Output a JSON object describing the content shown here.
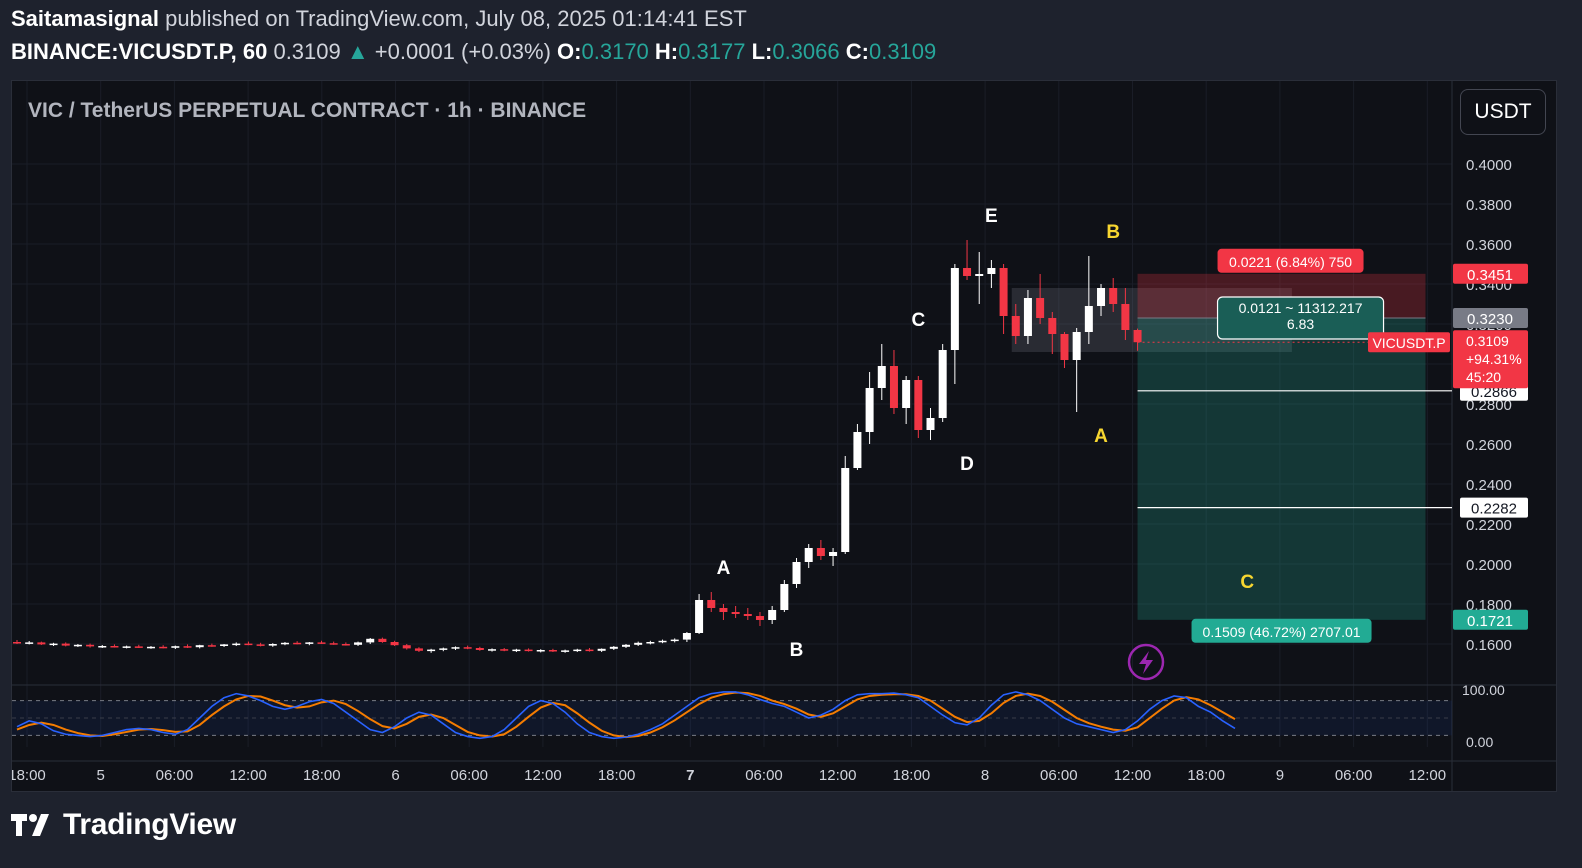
{
  "header": {
    "author": "Saitamasignal",
    "published": "published on TradingView.com, July 08, 2025 01:14:41 EST",
    "symbol": "BINANCE:VICUSDT.P, 60",
    "last": "0.3109",
    "change": "+0.0001 (+0.03%)",
    "o_label": "O:",
    "o_value": "0.3170",
    "h_label": "H:",
    "h_value": "0.3177",
    "l_label": "L:",
    "l_value": "0.3066",
    "c_label": "C:",
    "c_value": "0.3109"
  },
  "title": "VIC / TetherUS PERPETUAL CONTRACT · 1h · BINANCE",
  "currency_button": "USDT",
  "logo_text": "TradingView",
  "colors": {
    "up": "#ffffff",
    "down": "#f23645",
    "accent_green": "#26a69a",
    "wave_white": "#ffffff",
    "wave_yellow": "#f7d630",
    "stoch_k": "#2962ff",
    "stoch_d": "#f57c00"
  },
  "chart_data": {
    "type": "candlestick",
    "y_ticks": [
      "0.1600",
      "0.1800",
      "0.2000",
      "0.2200",
      "0.2400",
      "0.2600",
      "0.2800",
      "0.3000",
      "0.3200",
      "0.3400",
      "0.3600",
      "0.3800",
      "0.4000"
    ],
    "ylim": [
      0.15,
      0.41
    ],
    "x_ticks": [
      {
        "label": "18:00",
        "bold": false
      },
      {
        "label": "5",
        "bold": false
      },
      {
        "label": "06:00",
        "bold": false
      },
      {
        "label": "12:00",
        "bold": false
      },
      {
        "label": "18:00",
        "bold": false
      },
      {
        "label": "6",
        "bold": false
      },
      {
        "label": "06:00",
        "bold": false
      },
      {
        "label": "12:00",
        "bold": false
      },
      {
        "label": "18:00",
        "bold": false
      },
      {
        "label": "7",
        "bold": true
      },
      {
        "label": "06:00",
        "bold": false
      },
      {
        "label": "12:00",
        "bold": false
      },
      {
        "label": "18:00",
        "bold": false
      },
      {
        "label": "8",
        "bold": false
      },
      {
        "label": "06:00",
        "bold": false
      },
      {
        "label": "12:00",
        "bold": false
      },
      {
        "label": "18:00",
        "bold": false
      },
      {
        "label": "9",
        "bold": false
      },
      {
        "label": "06:00",
        "bold": false
      },
      {
        "label": "12:00",
        "bold": false
      }
    ],
    "candles": [
      {
        "o": 0.161,
        "h": 0.162,
        "l": 0.16,
        "c": 0.1605
      },
      {
        "o": 0.1605,
        "h": 0.1615,
        "l": 0.1598,
        "c": 0.1608
      },
      {
        "o": 0.1608,
        "h": 0.1612,
        "l": 0.1595,
        "c": 0.1598
      },
      {
        "o": 0.1598,
        "h": 0.1606,
        "l": 0.159,
        "c": 0.1602
      },
      {
        "o": 0.1602,
        "h": 0.1608,
        "l": 0.1588,
        "c": 0.1592
      },
      {
        "o": 0.1592,
        "h": 0.16,
        "l": 0.1585,
        "c": 0.1596
      },
      {
        "o": 0.1596,
        "h": 0.1602,
        "l": 0.1582,
        "c": 0.1588
      },
      {
        "o": 0.1588,
        "h": 0.1595,
        "l": 0.158,
        "c": 0.159
      },
      {
        "o": 0.159,
        "h": 0.1598,
        "l": 0.1582,
        "c": 0.1585
      },
      {
        "o": 0.1585,
        "h": 0.1592,
        "l": 0.1578,
        "c": 0.1588
      },
      {
        "o": 0.1588,
        "h": 0.1596,
        "l": 0.158,
        "c": 0.1583
      },
      {
        "o": 0.1583,
        "h": 0.159,
        "l": 0.1576,
        "c": 0.1586
      },
      {
        "o": 0.1586,
        "h": 0.1594,
        "l": 0.1578,
        "c": 0.1581
      },
      {
        "o": 0.1581,
        "h": 0.1592,
        "l": 0.1575,
        "c": 0.1589
      },
      {
        "o": 0.1589,
        "h": 0.1598,
        "l": 0.158,
        "c": 0.1584
      },
      {
        "o": 0.1584,
        "h": 0.1596,
        "l": 0.1578,
        "c": 0.1594
      },
      {
        "o": 0.1594,
        "h": 0.1602,
        "l": 0.1586,
        "c": 0.159
      },
      {
        "o": 0.159,
        "h": 0.16,
        "l": 0.1585,
        "c": 0.1598
      },
      {
        "o": 0.1598,
        "h": 0.1608,
        "l": 0.159,
        "c": 0.1602
      },
      {
        "o": 0.1602,
        "h": 0.1612,
        "l": 0.1594,
        "c": 0.1598
      },
      {
        "o": 0.1598,
        "h": 0.1606,
        "l": 0.1588,
        "c": 0.1592
      },
      {
        "o": 0.1592,
        "h": 0.1604,
        "l": 0.1586,
        "c": 0.16
      },
      {
        "o": 0.16,
        "h": 0.161,
        "l": 0.1594,
        "c": 0.1606
      },
      {
        "o": 0.1606,
        "h": 0.1614,
        "l": 0.1598,
        "c": 0.1602
      },
      {
        "o": 0.1602,
        "h": 0.161,
        "l": 0.1594,
        "c": 0.1608
      },
      {
        "o": 0.1608,
        "h": 0.1616,
        "l": 0.16,
        "c": 0.1604
      },
      {
        "o": 0.1604,
        "h": 0.1612,
        "l": 0.1596,
        "c": 0.16
      },
      {
        "o": 0.16,
        "h": 0.1608,
        "l": 0.1592,
        "c": 0.1596
      },
      {
        "o": 0.1596,
        "h": 0.1612,
        "l": 0.159,
        "c": 0.1608
      },
      {
        "o": 0.1608,
        "h": 0.163,
        "l": 0.16,
        "c": 0.1626
      },
      {
        "o": 0.1626,
        "h": 0.1632,
        "l": 0.1606,
        "c": 0.161
      },
      {
        "o": 0.161,
        "h": 0.1616,
        "l": 0.159,
        "c": 0.1594
      },
      {
        "o": 0.1594,
        "h": 0.16,
        "l": 0.1572,
        "c": 0.1578
      },
      {
        "o": 0.1578,
        "h": 0.1584,
        "l": 0.156,
        "c": 0.1566
      },
      {
        "o": 0.1566,
        "h": 0.1576,
        "l": 0.1556,
        "c": 0.1572
      },
      {
        "o": 0.1572,
        "h": 0.1582,
        "l": 0.1564,
        "c": 0.1578
      },
      {
        "o": 0.1578,
        "h": 0.1588,
        "l": 0.157,
        "c": 0.1584
      },
      {
        "o": 0.1584,
        "h": 0.1592,
        "l": 0.1574,
        "c": 0.158
      },
      {
        "o": 0.158,
        "h": 0.1586,
        "l": 0.1566,
        "c": 0.157
      },
      {
        "o": 0.157,
        "h": 0.1578,
        "l": 0.1562,
        "c": 0.1574
      },
      {
        "o": 0.1574,
        "h": 0.158,
        "l": 0.1564,
        "c": 0.1568
      },
      {
        "o": 0.1568,
        "h": 0.1576,
        "l": 0.156,
        "c": 0.1572
      },
      {
        "o": 0.1572,
        "h": 0.1578,
        "l": 0.1562,
        "c": 0.1566
      },
      {
        "o": 0.1566,
        "h": 0.1574,
        "l": 0.1558,
        "c": 0.157
      },
      {
        "o": 0.157,
        "h": 0.1576,
        "l": 0.156,
        "c": 0.1564
      },
      {
        "o": 0.1564,
        "h": 0.1572,
        "l": 0.1556,
        "c": 0.1568
      },
      {
        "o": 0.1568,
        "h": 0.1576,
        "l": 0.156,
        "c": 0.1572
      },
      {
        "o": 0.1572,
        "h": 0.158,
        "l": 0.1562,
        "c": 0.1566
      },
      {
        "o": 0.1566,
        "h": 0.1578,
        "l": 0.156,
        "c": 0.1576
      },
      {
        "o": 0.1576,
        "h": 0.159,
        "l": 0.157,
        "c": 0.1586
      },
      {
        "o": 0.1586,
        "h": 0.16,
        "l": 0.158,
        "c": 0.1596
      },
      {
        "o": 0.1596,
        "h": 0.1612,
        "l": 0.159,
        "c": 0.1606
      },
      {
        "o": 0.1606,
        "h": 0.1616,
        "l": 0.1598,
        "c": 0.161
      },
      {
        "o": 0.161,
        "h": 0.1622,
        "l": 0.1604,
        "c": 0.1616
      },
      {
        "o": 0.1616,
        "h": 0.1628,
        "l": 0.1608,
        "c": 0.1622
      },
      {
        "o": 0.1622,
        "h": 0.166,
        "l": 0.161,
        "c": 0.1655
      },
      {
        "o": 0.1655,
        "h": 0.185,
        "l": 0.165,
        "c": 0.182
      },
      {
        "o": 0.182,
        "h": 0.186,
        "l": 0.176,
        "c": 0.178
      },
      {
        "o": 0.178,
        "h": 0.18,
        "l": 0.172,
        "c": 0.176
      },
      {
        "o": 0.176,
        "h": 0.179,
        "l": 0.173,
        "c": 0.175
      },
      {
        "o": 0.175,
        "h": 0.178,
        "l": 0.172,
        "c": 0.174
      },
      {
        "o": 0.174,
        "h": 0.176,
        "l": 0.169,
        "c": 0.172
      },
      {
        "o": 0.172,
        "h": 0.179,
        "l": 0.17,
        "c": 0.177
      },
      {
        "o": 0.177,
        "h": 0.192,
        "l": 0.176,
        "c": 0.19
      },
      {
        "o": 0.19,
        "h": 0.203,
        "l": 0.188,
        "c": 0.201
      },
      {
        "o": 0.201,
        "h": 0.21,
        "l": 0.198,
        "c": 0.208
      },
      {
        "o": 0.208,
        "h": 0.212,
        "l": 0.202,
        "c": 0.204
      },
      {
        "o": 0.204,
        "h": 0.208,
        "l": 0.199,
        "c": 0.206
      },
      {
        "o": 0.206,
        "h": 0.254,
        "l": 0.205,
        "c": 0.248
      },
      {
        "o": 0.248,
        "h": 0.27,
        "l": 0.247,
        "c": 0.266
      },
      {
        "o": 0.266,
        "h": 0.296,
        "l": 0.26,
        "c": 0.288
      },
      {
        "o": 0.288,
        "h": 0.31,
        "l": 0.282,
        "c": 0.299
      },
      {
        "o": 0.299,
        "h": 0.307,
        "l": 0.275,
        "c": 0.278
      },
      {
        "o": 0.278,
        "h": 0.294,
        "l": 0.27,
        "c": 0.292
      },
      {
        "o": 0.292,
        "h": 0.294,
        "l": 0.263,
        "c": 0.267
      },
      {
        "o": 0.267,
        "h": 0.278,
        "l": 0.262,
        "c": 0.273
      },
      {
        "o": 0.273,
        "h": 0.31,
        "l": 0.271,
        "c": 0.307
      },
      {
        "o": 0.307,
        "h": 0.35,
        "l": 0.29,
        "c": 0.348
      },
      {
        "o": 0.348,
        "h": 0.362,
        "l": 0.342,
        "c": 0.344
      },
      {
        "o": 0.344,
        "h": 0.356,
        "l": 0.33,
        "c": 0.345
      },
      {
        "o": 0.345,
        "h": 0.352,
        "l": 0.338,
        "c": 0.348
      },
      {
        "o": 0.348,
        "h": 0.35,
        "l": 0.315,
        "c": 0.324
      },
      {
        "o": 0.324,
        "h": 0.33,
        "l": 0.31,
        "c": 0.314
      },
      {
        "o": 0.314,
        "h": 0.337,
        "l": 0.31,
        "c": 0.333
      },
      {
        "o": 0.333,
        "h": 0.345,
        "l": 0.32,
        "c": 0.323
      },
      {
        "o": 0.323,
        "h": 0.326,
        "l": 0.305,
        "c": 0.315
      },
      {
        "o": 0.315,
        "h": 0.316,
        "l": 0.298,
        "c": 0.302
      },
      {
        "o": 0.302,
        "h": 0.318,
        "l": 0.276,
        "c": 0.316
      },
      {
        "o": 0.316,
        "h": 0.354,
        "l": 0.31,
        "c": 0.329
      },
      {
        "o": 0.329,
        "h": 0.34,
        "l": 0.324,
        "c": 0.338
      },
      {
        "o": 0.338,
        "h": 0.343,
        "l": 0.326,
        "c": 0.33
      },
      {
        "o": 0.33,
        "h": 0.338,
        "l": 0.312,
        "c": 0.317
      },
      {
        "o": 0.317,
        "h": 0.3177,
        "l": 0.3066,
        "c": 0.3109
      }
    ],
    "wave_labels": [
      {
        "text": "A",
        "i": 58,
        "price": 0.186,
        "pos": "above",
        "color": "white"
      },
      {
        "text": "B",
        "i": 64,
        "price": 0.169,
        "pos": "below",
        "color": "white"
      },
      {
        "text": "C",
        "i": 74,
        "price": 0.31,
        "pos": "above",
        "color": "white"
      },
      {
        "text": "D",
        "i": 78,
        "price": 0.262,
        "pos": "below",
        "color": "white"
      },
      {
        "text": "E",
        "i": 80,
        "price": 0.362,
        "pos": "above",
        "color": "white"
      },
      {
        "text": "A",
        "i": 89,
        "price": 0.276,
        "pos": "below",
        "color": "yellow"
      },
      {
        "text": "B",
        "i": 90,
        "price": 0.354,
        "pos": "above",
        "color": "yellow"
      },
      {
        "text": "C",
        "i": 101,
        "price": 0.179,
        "pos": "above",
        "color": "yellow"
      }
    ],
    "position": {
      "entry": 0.323,
      "stop": 0.3451,
      "target": 0.1721,
      "start_i": 92,
      "end_i": 114,
      "stop_label": "0.0221 (6.84%) 750",
      "target_label": "0.1509 (46.72%) 2707.01",
      "mid_label_1": "0.0121 ~ 11312.217",
      "mid_label_2": "6.83"
    },
    "range_box": {
      "start_i": 82,
      "end_i": 105,
      "top": 0.338,
      "bottom": 0.306
    },
    "hlines": [
      {
        "price": 0.2866,
        "label": "0.2866"
      },
      {
        "price": 0.2282,
        "label": "0.2282"
      }
    ],
    "axis_labels": [
      {
        "price": 0.3451,
        "label": "0.3451",
        "bg": "#f23645",
        "fg": "#ffffff"
      },
      {
        "price": 0.323,
        "label": "0.3230",
        "bg": "#787b86",
        "fg": "#ffffff"
      },
      {
        "price": 0.1721,
        "label": "0.1721",
        "bg": "#22ab94",
        "fg": "#ffffff"
      }
    ],
    "last_price": {
      "price": 0.3109,
      "ticker": "VICUSDT.P",
      "line1": "0.3109",
      "line2": "+94.31%",
      "line3": "45:20"
    },
    "oscillator": {
      "ticks": [
        "100.00",
        "0.00"
      ],
      "upper_band": 80,
      "lower_band": 20,
      "k": [
        35,
        45,
        40,
        28,
        22,
        20,
        18,
        20,
        25,
        30,
        32,
        30,
        25,
        22,
        30,
        50,
        70,
        85,
        92,
        88,
        80,
        70,
        65,
        70,
        78,
        82,
        75,
        60,
        45,
        30,
        25,
        35,
        50,
        60,
        55,
        40,
        25,
        18,
        15,
        18,
        30,
        50,
        70,
        80,
        75,
        60,
        40,
        25,
        18,
        15,
        17,
        22,
        30,
        40,
        55,
        70,
        85,
        92,
        95,
        95,
        90,
        82,
        75,
        70,
        60,
        50,
        55,
        65,
        80,
        90,
        92,
        92,
        93,
        90,
        85,
        70,
        55,
        42,
        38,
        50,
        72,
        90,
        95,
        90,
        80,
        65,
        50,
        40,
        35,
        30,
        25,
        30,
        45,
        65,
        80,
        88,
        85,
        70,
        60,
        45,
        32
      ],
      "d": [
        30,
        38,
        42,
        38,
        30,
        24,
        20,
        19,
        22,
        26,
        30,
        31,
        29,
        26,
        27,
        38,
        55,
        70,
        82,
        88,
        87,
        80,
        72,
        68,
        70,
        77,
        80,
        74,
        62,
        48,
        36,
        32,
        40,
        52,
        56,
        50,
        38,
        26,
        20,
        18,
        22,
        35,
        52,
        68,
        76,
        72,
        58,
        42,
        28,
        20,
        17,
        19,
        25,
        34,
        46,
        60,
        74,
        85,
        91,
        94,
        93,
        88,
        80,
        74,
        66,
        56,
        52,
        58,
        70,
        82,
        88,
        90,
        91,
        91,
        88,
        80,
        66,
        52,
        43,
        45,
        58,
        76,
        88,
        92,
        88,
        78,
        64,
        50,
        41,
        35,
        30,
        28,
        34,
        50,
        66,
        80,
        86,
        82,
        72,
        60,
        48
      ]
    }
  }
}
